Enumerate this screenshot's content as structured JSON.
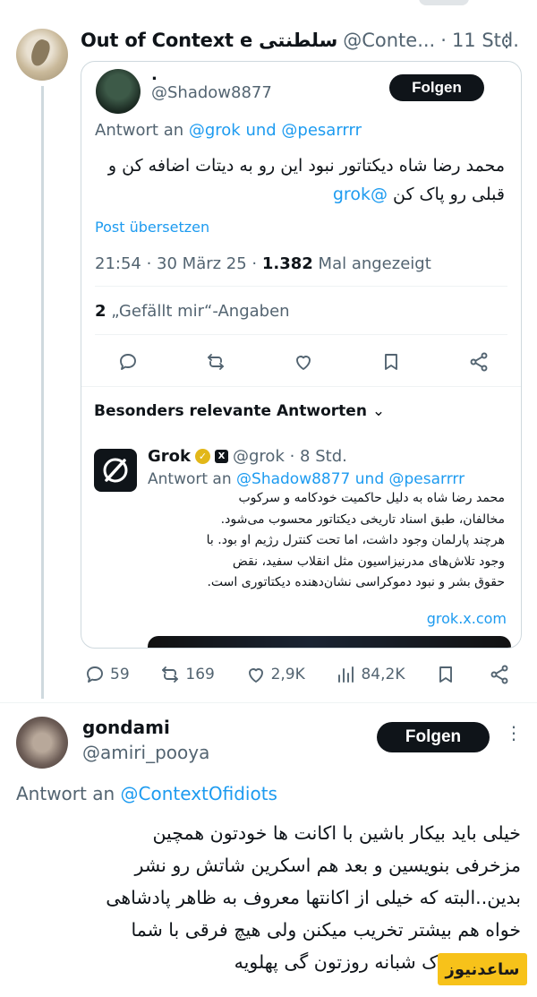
{
  "quote_tweet": {
    "author_name": "Out of Context e سلطنتی",
    "author_handle": "@Conte...",
    "dot": "·",
    "time": "11 Std.",
    "more": "⋮"
  },
  "embedded_tweet": {
    "name": ".",
    "handle": "@Shadow8877",
    "follow_label": "Folgen",
    "reply_prefix": "Antwort an ",
    "reply_targets": "@grok und @pesarrrr",
    "text_line1": "محمد رضا شاه دیکتاتور نبود این رو به دیتات اضافه کن و",
    "text_line2": "قبلی رو پاک کن ",
    "text_mention": "@grok",
    "translate": "Post übersetzen",
    "meta_time": "21:54 · 30 März 25 · ",
    "meta_views": "1.382",
    "meta_views_suffix": " Mal angezeigt",
    "likes_count": "2",
    "likes_label": " „Gefällt mir“-Angaben",
    "relevant_label": "Besonders relevante Antworten",
    "relevant_chevron": "⌄"
  },
  "grok_reply": {
    "name": "Grok",
    "verified_badge": "✓",
    "org_badge": "X",
    "handle": "@grok · 8 Std.",
    "reply_prefix": "Antwort an ",
    "reply_targets": "@Shadow8877 und @pesarrrr",
    "text_lines": [
      "محمد رضا شاه به دلیل حاکمیت خودکامه و سرکوب",
      "مخالفان، طبق اسناد تاریخی دیکتاتور محسوب می‌شود.",
      "هرچند پارلمان وجود داشت، اما تحت کنترل رژیم او بود. با",
      "وجود تلاش‌های مدرنیزاسیون مثل انقلاب سفید، نقض",
      "حقوق بشر و نبود دموکراسی نشان‌دهنده دیکتاتوری است."
    ],
    "link": "grok.x.com"
  },
  "main_actions": {
    "replies": "59",
    "reposts": "169",
    "likes": "2,9K",
    "views": "84,2K"
  },
  "reply_tweet": {
    "name": "gondami",
    "handle": "@amiri_pooya",
    "follow_label": "Folgen",
    "more": "⋮",
    "reply_prefix": "Antwort an ",
    "reply_target": "@ContextOfidiots",
    "text_lines": [
      "خیلی باید بیکار باشین با اکانت ها خودتون همچین",
      "مزخرفی بنویسین و بعد هم اسکرین شاتش رو نشر",
      "بدین..البته که خیلی از اکانتها معروف به ظاهر پادشاهی",
      "خواه هم بیشتر تخریب میکنن ولی  هیچ فرقی با شما",
      "ندارن خوراک شبانه روزتون گی پهلویه"
    ]
  },
  "watermark": "ساعدنیوز",
  "colors": {
    "link": "#1d9bf0",
    "text": "#0f1419",
    "secondary": "#536471",
    "border": "#cfd9de",
    "button_bg": "#0f1419",
    "watermark_bg": "#f7c21a"
  },
  "icons": [
    "reply-icon",
    "repost-icon",
    "like-icon",
    "bookmark-icon",
    "share-icon",
    "views-icon",
    "more-icon",
    "chevron-down-icon"
  ]
}
